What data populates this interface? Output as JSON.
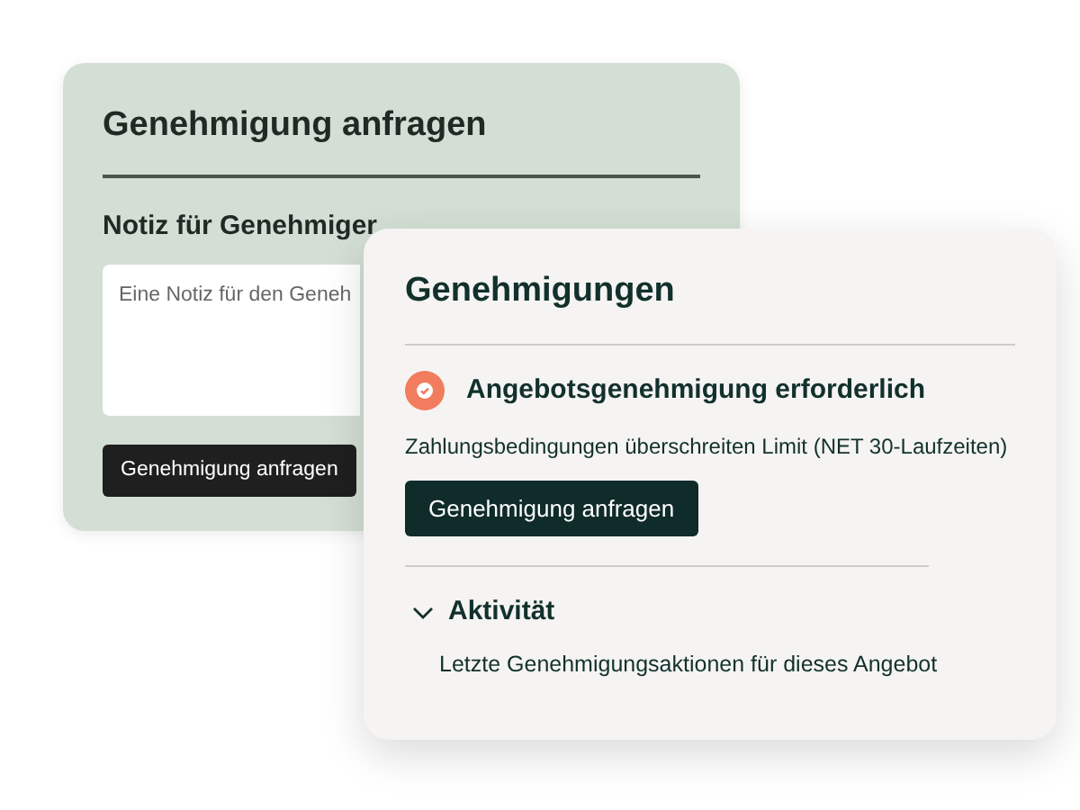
{
  "request_panel": {
    "title": "Genehmigung anfragen",
    "note_label": "Notiz für Genehmiger",
    "note_field": {
      "placeholder": "Eine Notiz für den Geneh"
    },
    "button": "Genehmigung anfragen"
  },
  "approvals_panel": {
    "title": "Genehmigungen",
    "alert": {
      "title": "Angebotsgenehmigung erforderlich",
      "message": "Zahlungsbedingungen überschreiten Limit (NET 30-Laufzeiten)",
      "button": "Genehmigung anfragen"
    },
    "activity": {
      "title": "Aktivität",
      "expanded": true,
      "description": "Letzte Genehmigungsaktionen für dieses Angebot"
    }
  }
}
